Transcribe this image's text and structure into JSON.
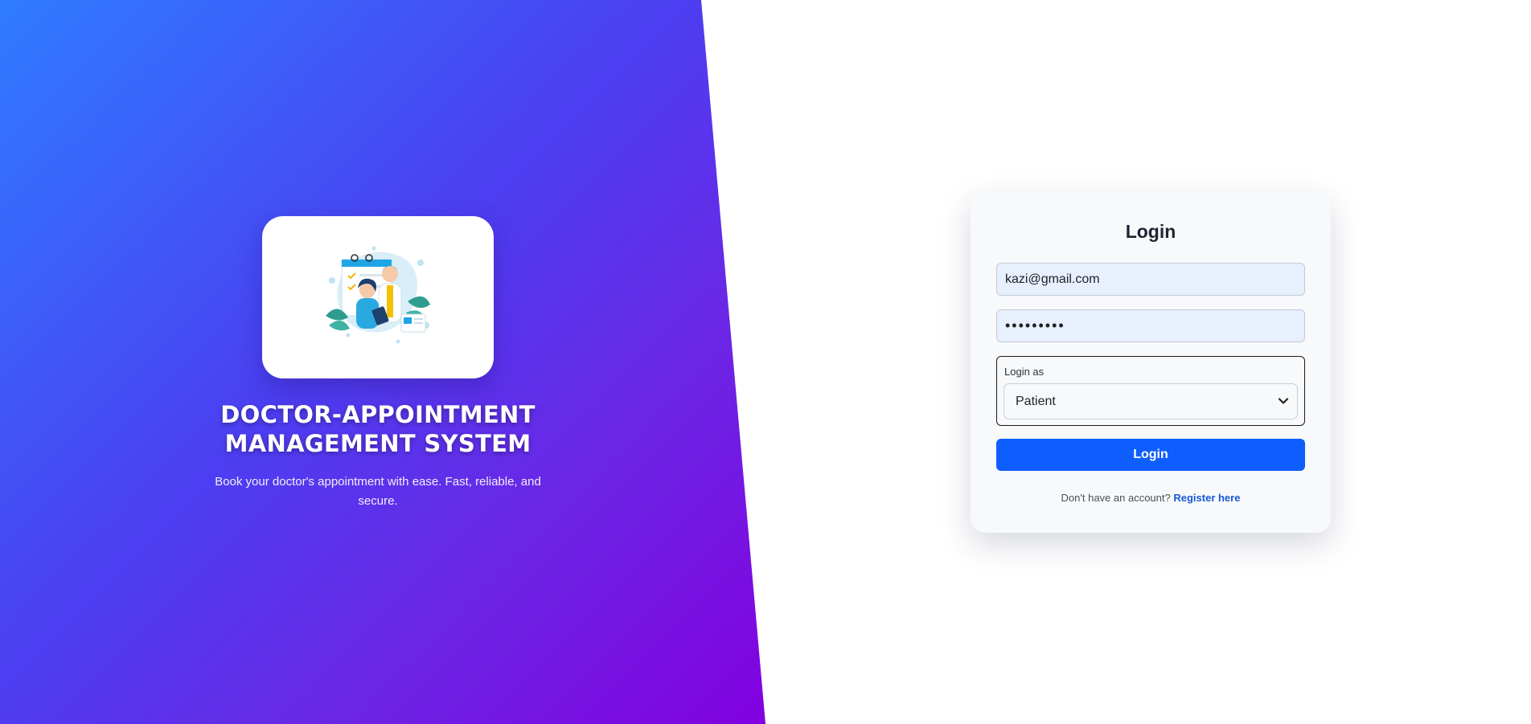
{
  "hero": {
    "title_line1": "DOCTOR-APPOINTMENT",
    "title_line2": "MANAGEMENT SYSTEM",
    "subtitle": "Book your doctor's appointment with ease. Fast, reliable, and secure.",
    "illustration_icon": "doctor-consultation-illustration"
  },
  "login": {
    "title": "Login",
    "email_value": "kazi@gmail.com",
    "email_placeholder": "Email",
    "password_masked": "•••••••••",
    "password_placeholder": "Password",
    "role_label": "Login as",
    "role_selected": "Patient",
    "submit_label": "Login",
    "register_prompt": "Don't have an account?",
    "register_link": "Register here"
  },
  "colors": {
    "gradient_start": "#2f7cff",
    "gradient_end": "#8200e0",
    "primary_button": "#0d5efd",
    "link": "#1758d6",
    "input_fill": "#e8f0fe"
  },
  "icons": {
    "select_arrow": "chevron-down-icon"
  }
}
